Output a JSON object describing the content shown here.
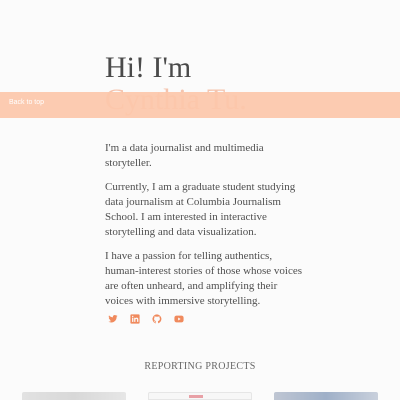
{
  "hero": {
    "line1": "Hi! I'm",
    "line2": "Cynthia Tu."
  },
  "nav": {
    "back_to_top": "Back to top"
  },
  "bio": {
    "paragraphs": [
      "I'm a data journalist and multimedia storyteller.",
      "Currently, I am a graduate student studying data journalism at Columbia Journalism School. I am interested in interactive storytelling and data visualization.",
      "I have a passion for telling authentics, human-interest stories of those whose voices are often unheard, and amplifying their voices with immersive storytelling."
    ]
  },
  "socials": [
    {
      "icon": "twitter-icon"
    },
    {
      "icon": "linkedin-icon"
    },
    {
      "icon": "github-icon"
    },
    {
      "icon": "youtube-icon"
    }
  ],
  "colors": {
    "accent": "#f08a5d",
    "bar": "#fcc7aa"
  },
  "section": {
    "reporting_title": "REPORTING PROJECTS"
  }
}
